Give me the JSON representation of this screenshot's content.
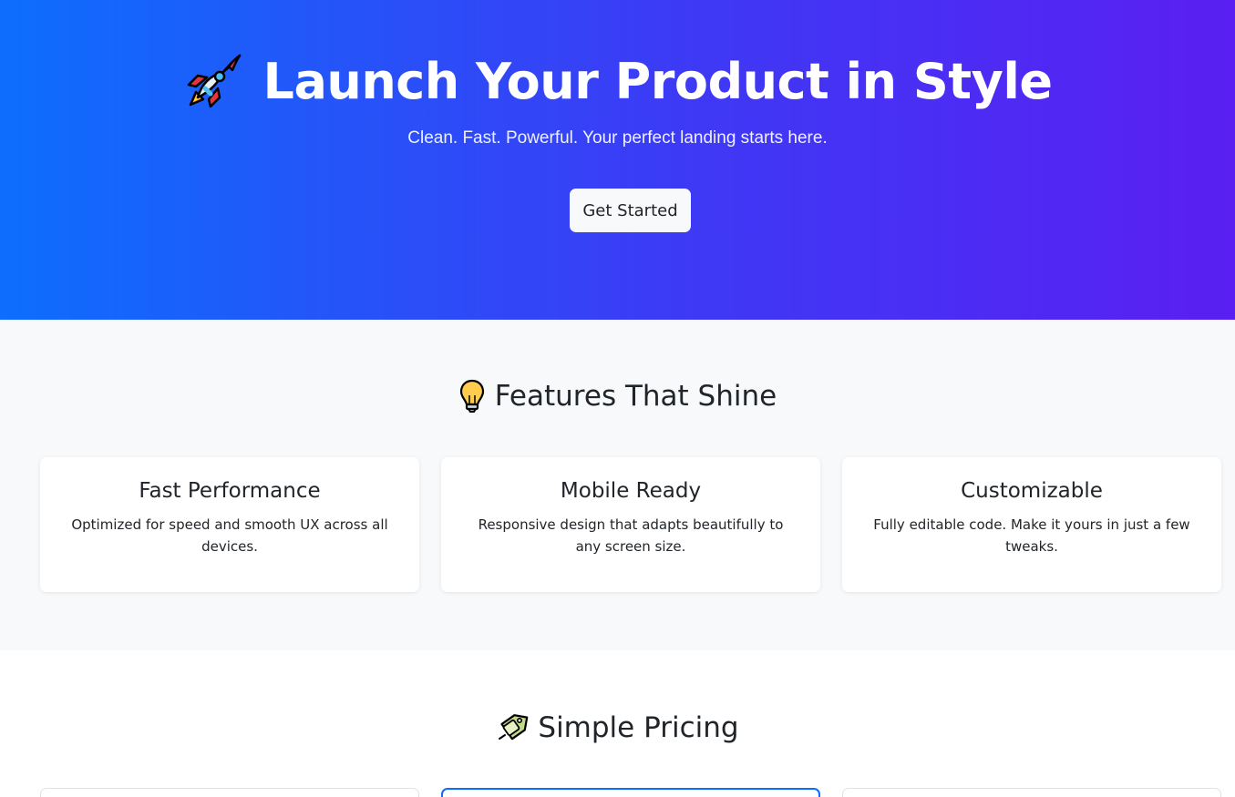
{
  "hero": {
    "title": "Launch Your Product in Style",
    "subtitle": "Clean. Fast. Powerful. Your perfect landing starts here.",
    "cta_label": "Get Started",
    "icon": "rocket-icon",
    "gradient": [
      "#0d6efd",
      "#5a1ff2"
    ]
  },
  "features": {
    "title": "Features That Shine",
    "icon": "lightbulb-icon",
    "items": [
      {
        "title": "Fast Performance",
        "text": "Optimized for speed and smooth UX across all devices."
      },
      {
        "title": "Mobile Ready",
        "text": "Responsive design that adapts beautifully to any screen size."
      },
      {
        "title": "Customizable",
        "text": "Fully editable code. Make it yours in just a few tweaks."
      }
    ]
  },
  "pricing": {
    "title": "Simple Pricing",
    "icon": "price-tag-icon",
    "accent": "#0d6efd"
  }
}
